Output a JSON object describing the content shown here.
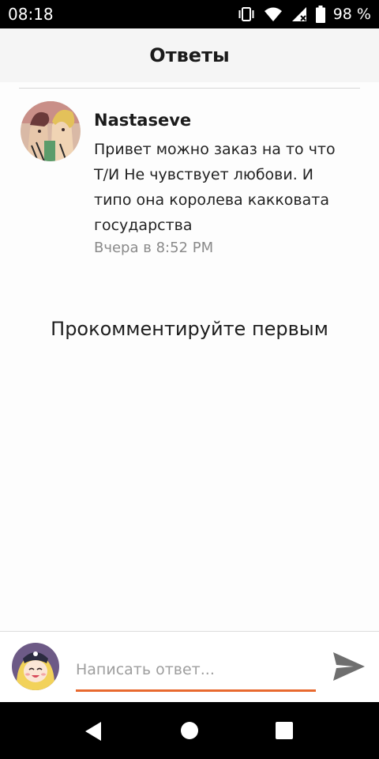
{
  "status_bar": {
    "time": "08:18",
    "battery": "98 %",
    "icons": [
      "vibrate-icon",
      "wifi-icon",
      "signal-icon",
      "battery-icon"
    ]
  },
  "header": {
    "title": "Ответы"
  },
  "comment": {
    "author": "Nastaseve",
    "text": "Привет можно заказ на то что Т/И Не чувствует любови. И типо она королева какковата государства",
    "time": "Вчера в 8:52 PM"
  },
  "empty_state": "Прокомментируйте первым",
  "reply": {
    "placeholder": "Написать ответ...",
    "value": "",
    "accent_color": "#e8692f"
  },
  "nav": {
    "icons": [
      "back-icon",
      "home-icon",
      "recents-icon"
    ]
  }
}
